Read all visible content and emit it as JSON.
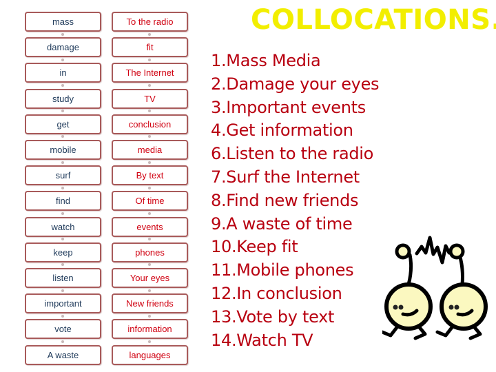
{
  "title": "COLLOCATIONS.",
  "colors": {
    "title": "#f2ee00",
    "left_words": "#1f3a5a",
    "right_words": "#d00010",
    "list_text": "#b80010",
    "box_border": "#a85a5a",
    "cartoon_face": "#fbf8c0"
  },
  "left_column": [
    "mass",
    "damage",
    "in",
    "study",
    "get",
    "mobile",
    "surf",
    "find",
    "watch",
    "keep",
    "listen",
    "important",
    "vote",
    "A  waste"
  ],
  "right_column": [
    "To the radio",
    "fit",
    "The Internet",
    "TV",
    "conclusion",
    "media",
    "By text",
    "Of time",
    "events",
    "phones",
    "Your eyes",
    "New friends",
    "information",
    "languages"
  ],
  "answers": [
    "1.Mass  Media",
    "2.Damage  your  eyes",
    "3.Important events",
    "4.Get information",
    "6.Listen to the radio",
    "7.Surf  the  Internet",
    "8.Find new friends",
    "9.A  waste of  time",
    "10.Keep fit",
    "11.Mobile phones",
    "12.In conclusion",
    "13.Vote  by  text",
    "14.Watch  TV"
  ],
  "illustration": {
    "icon": "two-cartoon-characters-icon"
  }
}
